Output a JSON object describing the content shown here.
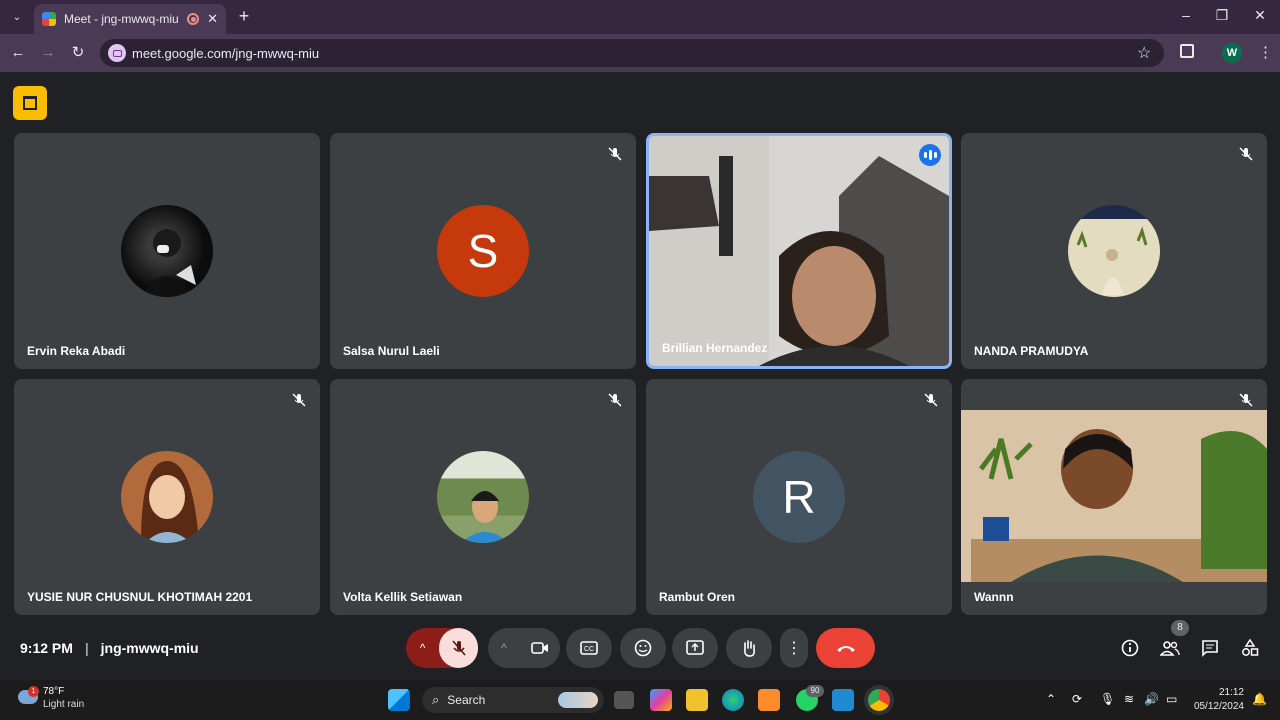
{
  "browser": {
    "tab_title": "Meet - jng-mwwq-miu",
    "url": "meet.google.com/jng-mwwq-miu",
    "profile_initial": "W"
  },
  "participants": [
    {
      "name": "Ervin Reka Abadi",
      "avatar": "photo",
      "avatar_color": "#0c0c0c",
      "muted": false
    },
    {
      "name": "Salsa Nurul Laeli",
      "avatar": "initial",
      "initial": "S",
      "avatar_color": "#c5390c",
      "muted": true
    },
    {
      "name": "Brillian Hernandez",
      "avatar": "video",
      "muted": false,
      "speaking": true
    },
    {
      "name": "NANDA PRAMUDYA",
      "avatar": "photo",
      "avatar_color": "#d9d3b0",
      "muted": true
    },
    {
      "name": "YUSIE NUR CHUSNUL KHOTIMAH 2201",
      "avatar": "photo",
      "avatar_color": "#b26a3c",
      "muted": true
    },
    {
      "name": "Volta Kellik Setiawan",
      "avatar": "photo",
      "avatar_color": "#6f8a4e",
      "muted": true
    },
    {
      "name": "Rambut Oren",
      "avatar": "initial",
      "initial": "R",
      "avatar_color": "#425461",
      "muted": true
    },
    {
      "name": "Wannn",
      "avatar": "video",
      "muted": true
    }
  ],
  "meeting": {
    "time": "9:12 PM",
    "code": "jng-mwwq-miu",
    "participant_count": "8"
  },
  "taskbar": {
    "temp": "78°F",
    "weather": "Light rain",
    "weather_badge": "1",
    "search": "Search",
    "whatsapp_badge": "90",
    "time": "21:12",
    "date": "05/12/2024"
  },
  "colors": {
    "accent": "#8ab4f8",
    "end_call": "#ea4335",
    "mic_off": "#f9dedc"
  }
}
